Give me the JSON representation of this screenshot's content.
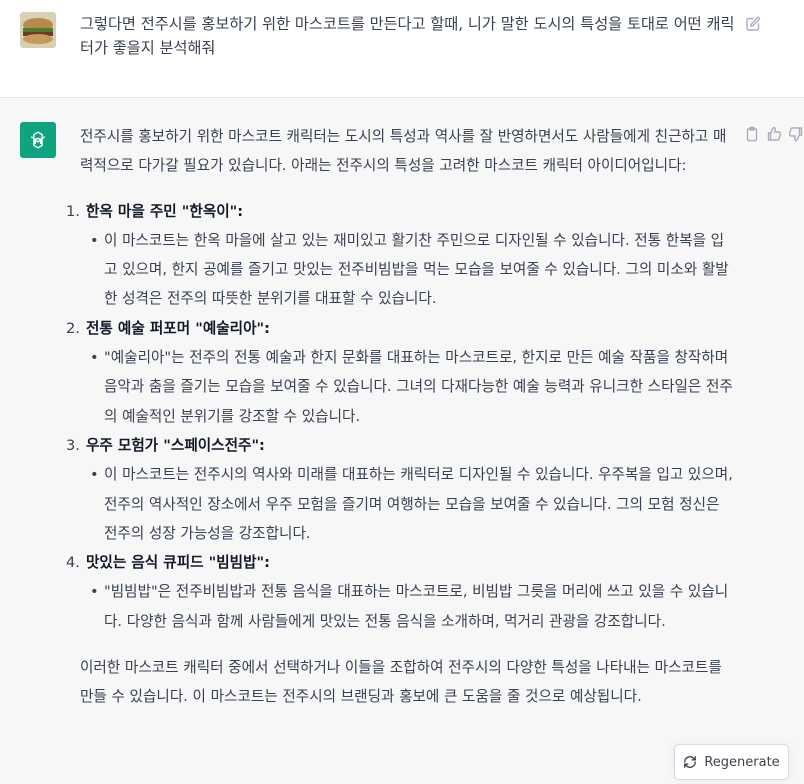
{
  "user_message": {
    "text": "그렇다면 전주시를 홍보하기 위한 마스코트를 만든다고 할때, 니가 말한 도시의 특성을 토대로 어떤 캐릭터가 좋을지 분석해줘"
  },
  "assistant_message": {
    "intro": "전주시를 홍보하기 위한 마스코트 캐릭터는 도시의 특성과 역사를 잘 반영하면서도 사람들에게 친근하고 매력적으로 다가갈 필요가 있습니다. 아래는 전주시의 특성을 고려한 마스코트 캐릭터 아이디어입니다:",
    "items": [
      {
        "number": "1.",
        "title": "한옥 마을 주민 \"한옥이\":",
        "detail": "이 마스코트는 한옥 마을에 살고 있는 재미있고 활기찬 주민으로 디자인될 수 있습니다. 전통 한복을 입고 있으며, 한지 공예를 즐기고 맛있는 전주비빔밥을 먹는 모습을 보여줄 수 있습니다. 그의 미소와 활발한 성격은 전주의 따뜻한 분위기를 대표할 수 있습니다."
      },
      {
        "number": "2.",
        "title": "전통 예술 퍼포머 \"예술리아\":",
        "detail": "\"예술리아\"는 전주의 전통 예술과 한지 문화를 대표하는 마스코트로, 한지로 만든 예술 작품을 창작하며 음악과 춤을 즐기는 모습을 보여줄 수 있습니다. 그녀의 다재다능한 예술 능력과 유니크한 스타일은 전주의 예술적인 분위기를 강조할 수 있습니다."
      },
      {
        "number": "3.",
        "title": "우주 모험가 \"스페이스전주\":",
        "detail": "이 마스코트는 전주시의 역사와 미래를 대표하는 캐릭터로 디자인될 수 있습니다. 우주복을 입고 있으며, 전주의 역사적인 장소에서 우주 모험을 즐기며 여행하는 모습을 보여줄 수 있습니다. 그의 모험 정신은 전주의 성장 가능성을 강조합니다."
      },
      {
        "number": "4.",
        "title": "맛있는 음식 큐피드 \"빔빔밥\":",
        "detail": "\"빔빔밥\"은 전주비빔밥과 전통 음식을 대표하는 마스코트로, 비빔밥 그릇을 머리에 쓰고 있을 수 있습니다. 다양한 음식과 함께 사람들에게 맛있는 전통 음식을 소개하며, 먹거리 관광을 강조합니다."
      }
    ],
    "outro": "이러한 마스코트 캐릭터 중에서 선택하거나 이들을 조합하여 전주시의 다양한 특성을 나타내는 마스코트를 만들 수 있습니다. 이 마스코트는 전주시의 브랜딩과 홍보에 큰 도움을 줄 것으로 예상됩니다."
  },
  "regenerate": {
    "label": "Regenerate"
  },
  "icons": {
    "edit": "edit-icon",
    "copy": "clipboard-icon",
    "like": "thumbs-up-icon",
    "dislike": "thumbs-down-icon",
    "regenerate": "refresh-icon",
    "assistant_logo": "openai-logo-icon"
  },
  "colors": {
    "assistant_bg": "#f7f7f8",
    "avatar_green": "#10a37f",
    "text": "#374151"
  }
}
